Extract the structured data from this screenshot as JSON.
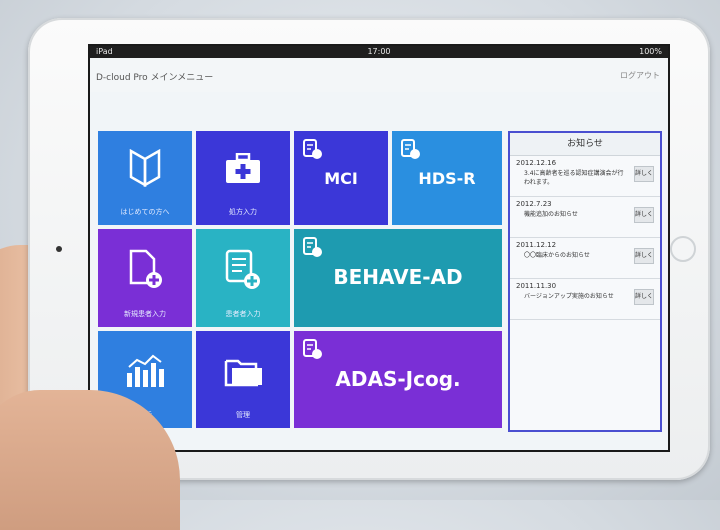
{
  "status_bar": {
    "device": "iPad",
    "time": "17:00",
    "battery": "100%"
  },
  "app": {
    "title": "D-cloud Pro メインメニュー",
    "right_link": "ログアウト"
  },
  "tiles": {
    "beginner": {
      "label": "はじめての方へ"
    },
    "medical_input": {
      "label": "処方入力"
    },
    "mci": {
      "label": "MCI"
    },
    "hdsr": {
      "label": "HDS-R"
    },
    "new_patient": {
      "label": "新規患者入力"
    },
    "patient_input": {
      "label": "患者者入力"
    },
    "behave_ad": {
      "label": "BEHAVE-AD"
    },
    "analysis": {
      "label": "分析"
    },
    "management": {
      "label": "管理"
    },
    "adas": {
      "label": "ADAS-Jcog."
    }
  },
  "news": {
    "header": "お知らせ",
    "items": [
      {
        "date": "2012.12.16",
        "text": "3.4に高齢者を巡る認知症講演会が行われます。",
        "button": "詳しく"
      },
      {
        "date": "2012.7.23",
        "text": "機能追加のお知らせ",
        "button": "詳しく"
      },
      {
        "date": "2011.12.12",
        "text": "〇〇臨床からのお知らせ",
        "button": "詳しく"
      },
      {
        "date": "2011.11.30",
        "text": "バージョンアップ実施のお知らせ",
        "button": "詳しく"
      }
    ]
  },
  "colors": {
    "blue": "#2f7fe0",
    "indigo": "#3b37d8",
    "purple": "#7a2fd6",
    "teal": "#29b3c4",
    "teal_dark": "#1e9bb0",
    "sky": "#2a8fe0"
  }
}
